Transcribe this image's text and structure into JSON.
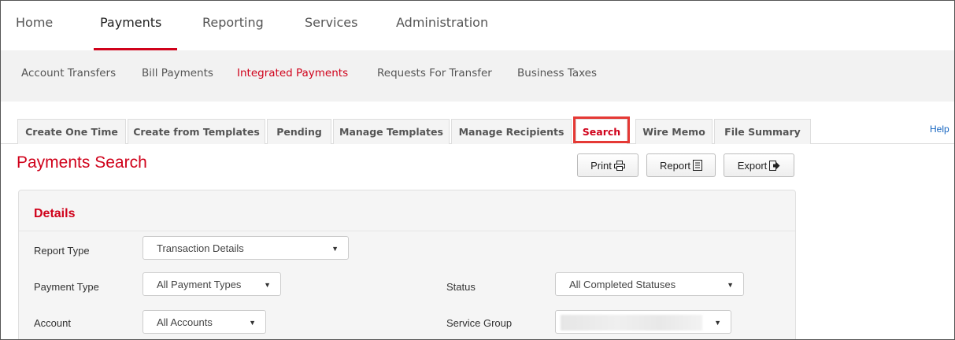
{
  "top_nav": {
    "items": [
      "Home",
      "Payments",
      "Reporting",
      "Services",
      "Administration"
    ],
    "active": "Payments"
  },
  "sub_nav": {
    "items": [
      "Account Transfers",
      "Bill Payments",
      "Integrated Payments",
      "Requests For Transfer",
      "Business Taxes"
    ],
    "active": "Integrated Payments"
  },
  "tabs": {
    "items": [
      "Create One Time",
      "Create from Templates",
      "Pending",
      "Manage Templates",
      "Manage Recipients",
      "Search",
      "Wire Memo",
      "File Summary"
    ],
    "active": "Search",
    "help_label": "Help"
  },
  "page": {
    "title": "Payments Search",
    "buttons": {
      "print": "Print",
      "report": "Report",
      "export": "Export"
    }
  },
  "details": {
    "heading": "Details",
    "report_type": {
      "label": "Report Type",
      "value": "Transaction Details"
    },
    "payment_type": {
      "label": "Payment Type",
      "value": "All Payment Types"
    },
    "status": {
      "label": "Status",
      "value": "All Completed Statuses"
    },
    "account": {
      "label": "Account",
      "value": "All Accounts"
    },
    "service_group": {
      "label": "Service Group",
      "value": ""
    }
  },
  "colors": {
    "accent": "#d0021b",
    "highlight_box": "#e53935",
    "help_link": "#1565c0"
  }
}
